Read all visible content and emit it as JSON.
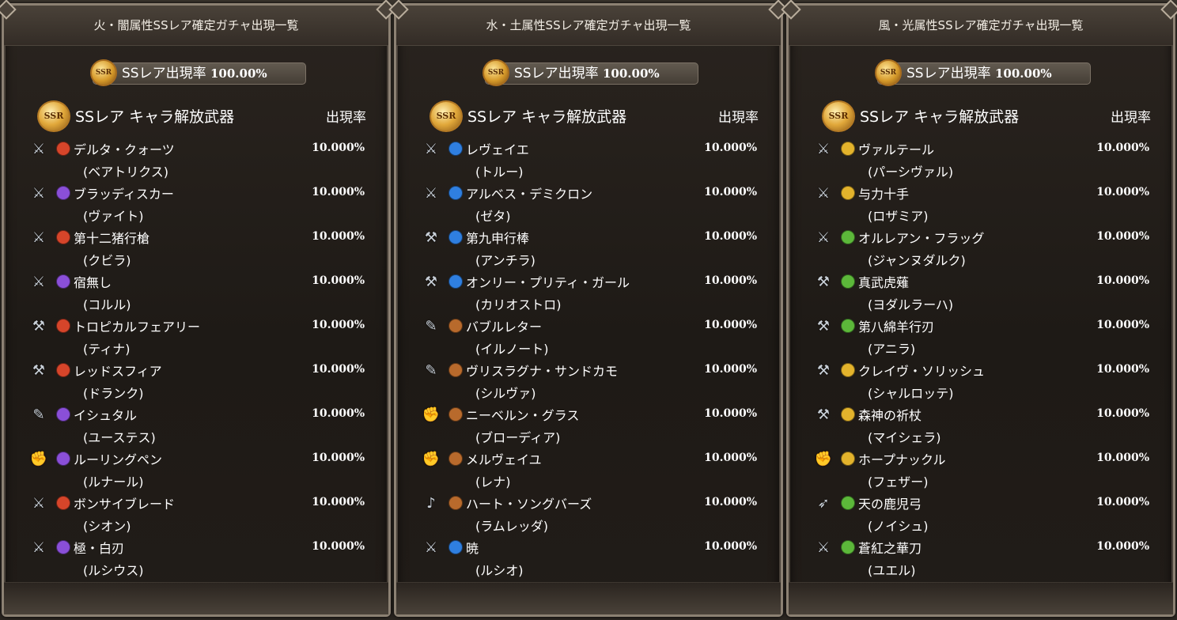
{
  "colors": {
    "fire": "#d6452a",
    "dark": "#8a4fd8",
    "water": "#2f7fe0",
    "earth": "#b86a2c",
    "wind": "#5cb83a",
    "light": "#e3b32c"
  },
  "panels": [
    {
      "title": "火・闇属性SSレア確定ガチャ出現一覧",
      "rate_label": "SSレア出現率",
      "rate_value": "100.00%",
      "medal_text": "SSR",
      "header_label": "SSレア キャラ解放武器",
      "header_rate": "出現率",
      "items": [
        {
          "icon": "sword-icon",
          "glyph": "⚔",
          "element": "fire",
          "weapon": "デルタ・クォーツ",
          "chara": "(ベアトリクス)",
          "rate": "10.000%"
        },
        {
          "icon": "sword-icon",
          "glyph": "⚔",
          "element": "dark",
          "weapon": "ブラッディスカー",
          "chara": "(ヴァイト)",
          "rate": "10.000%"
        },
        {
          "icon": "spear-icon",
          "glyph": "⚔",
          "element": "fire",
          "weapon": "第十二猪行槍",
          "chara": "(クビラ)",
          "rate": "10.000%"
        },
        {
          "icon": "spear-icon",
          "glyph": "⚔",
          "element": "dark",
          "weapon": "宿無し",
          "chara": "(コルル)",
          "rate": "10.000%"
        },
        {
          "icon": "axe-icon",
          "glyph": "⚒",
          "element": "fire",
          "weapon": "トロピカルフェアリー",
          "chara": "(ティナ)",
          "rate": "10.000%"
        },
        {
          "icon": "axe-icon",
          "glyph": "⚒",
          "element": "fire",
          "weapon": "レッドスフィア",
          "chara": "(ドランク)",
          "rate": "10.000%"
        },
        {
          "icon": "staff-icon",
          "glyph": "✎",
          "element": "dark",
          "weapon": "イシュタル",
          "chara": "(ユーステス)",
          "rate": "10.000%"
        },
        {
          "icon": "fist-icon",
          "glyph": "✊",
          "element": "dark",
          "weapon": "ルーリングペン",
          "chara": "(ルナール)",
          "rate": "10.000%"
        },
        {
          "icon": "dual-sword-icon",
          "glyph": "⚔",
          "element": "fire",
          "weapon": "ボンサイブレード",
          "chara": "(シオン)",
          "rate": "10.000%"
        },
        {
          "icon": "dual-sword-icon",
          "glyph": "⚔",
          "element": "dark",
          "weapon": "極・白刃",
          "chara": "(ルシウス)",
          "rate": "10.000%"
        }
      ]
    },
    {
      "title": "水・土属性SSレア確定ガチャ出現一覧",
      "rate_label": "SSレア出現率",
      "rate_value": "100.00%",
      "medal_text": "SSR",
      "header_label": "SSレア キャラ解放武器",
      "header_rate": "出現率",
      "items": [
        {
          "icon": "sword-icon",
          "glyph": "⚔",
          "element": "water",
          "weapon": "レヴェイエ",
          "chara": "(トルー)",
          "rate": "10.000%"
        },
        {
          "icon": "spear-icon",
          "glyph": "⚔",
          "element": "water",
          "weapon": "アルベス・デミクロン",
          "chara": "(ゼタ)",
          "rate": "10.000%"
        },
        {
          "icon": "axe-icon",
          "glyph": "⚒",
          "element": "water",
          "weapon": "第九申行棒",
          "chara": "(アンチラ)",
          "rate": "10.000%"
        },
        {
          "icon": "axe-icon",
          "glyph": "⚒",
          "element": "water",
          "weapon": "オンリー・プリティ・ガール",
          "chara": "(カリオストロ)",
          "rate": "10.000%"
        },
        {
          "icon": "staff-icon",
          "glyph": "✎",
          "element": "earth",
          "weapon": "バブルレター",
          "chara": "(イルノート)",
          "rate": "10.000%"
        },
        {
          "icon": "staff-icon",
          "glyph": "✎",
          "element": "earth",
          "weapon": "ヴリスラグナ・サンドカモ",
          "chara": "(シルヴァ)",
          "rate": "10.000%"
        },
        {
          "icon": "fist-icon",
          "glyph": "✊",
          "element": "earth",
          "weapon": "ニーベルン・グラス",
          "chara": "(ブローディア)",
          "rate": "10.000%"
        },
        {
          "icon": "fist-icon",
          "glyph": "✊",
          "element": "earth",
          "weapon": "メルヴェイユ",
          "chara": "(レナ)",
          "rate": "10.000%"
        },
        {
          "icon": "harp-icon",
          "glyph": "♪",
          "element": "earth",
          "weapon": "ハート・ソングバーズ",
          "chara": "(ラムレッダ)",
          "rate": "10.000%"
        },
        {
          "icon": "dual-sword-icon",
          "glyph": "⚔",
          "element": "water",
          "weapon": "暁",
          "chara": "(ルシオ)",
          "rate": "10.000%"
        }
      ]
    },
    {
      "title": "風・光属性SSレア確定ガチャ出現一覧",
      "rate_label": "SSレア出現率",
      "rate_value": "100.00%",
      "medal_text": "SSR",
      "header_label": "SSレア キャラ解放武器",
      "header_rate": "出現率",
      "items": [
        {
          "icon": "spear-icon",
          "glyph": "⚔",
          "element": "light",
          "weapon": "ヴァルテール",
          "chara": "(パーシヴァル)",
          "rate": "10.000%"
        },
        {
          "icon": "spear-icon",
          "glyph": "⚔",
          "element": "light",
          "weapon": "与力十手",
          "chara": "(ロザミア)",
          "rate": "10.000%"
        },
        {
          "icon": "spear-icon",
          "glyph": "⚔",
          "element": "wind",
          "weapon": "オルレアン・フラッグ",
          "chara": "(ジャンヌダルク)",
          "rate": "10.000%"
        },
        {
          "icon": "axe-icon",
          "glyph": "⚒",
          "element": "wind",
          "weapon": "真武虎薙",
          "chara": "(ヨダルラーハ)",
          "rate": "10.000%"
        },
        {
          "icon": "axe-icon",
          "glyph": "⚒",
          "element": "wind",
          "weapon": "第八綿羊行刃",
          "chara": "(アニラ)",
          "rate": "10.000%"
        },
        {
          "icon": "axe-icon",
          "glyph": "⚒",
          "element": "light",
          "weapon": "クレイヴ・ソリッシュ",
          "chara": "(シャルロッテ)",
          "rate": "10.000%"
        },
        {
          "icon": "axe-icon",
          "glyph": "⚒",
          "element": "light",
          "weapon": "森神の祈杖",
          "chara": "(マイシェラ)",
          "rate": "10.000%"
        },
        {
          "icon": "fist-icon",
          "glyph": "✊",
          "element": "light",
          "weapon": "ホープナックル",
          "chara": "(フェザー)",
          "rate": "10.000%"
        },
        {
          "icon": "bow-icon",
          "glyph": "➶",
          "element": "wind",
          "weapon": "天の鹿児弓",
          "chara": "(ノイシュ)",
          "rate": "10.000%"
        },
        {
          "icon": "dual-sword-icon",
          "glyph": "⚔",
          "element": "wind",
          "weapon": "蒼紅之華刀",
          "chara": "(ユエル)",
          "rate": "10.000%"
        }
      ]
    }
  ]
}
